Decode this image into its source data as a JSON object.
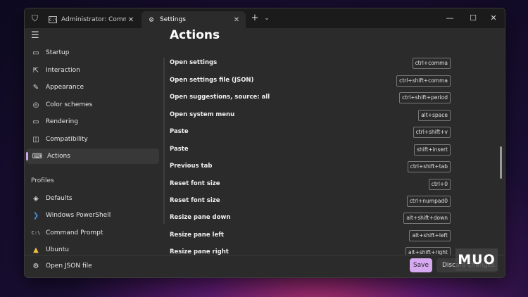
{
  "titlebar": {
    "tabs": [
      {
        "label": "Administrator: Command Pron",
        "icon": "terminal-icon"
      },
      {
        "label": "Settings",
        "icon": "gear-icon",
        "active": true
      }
    ],
    "new_tab_label": "+",
    "dropdown_label": "⌄",
    "close_label": "✕",
    "minimize_label": "—",
    "maximize_label": "☐"
  },
  "sidebar": {
    "items": [
      {
        "label": "Startup",
        "icon": "startup-icon"
      },
      {
        "label": "Interaction",
        "icon": "interaction-icon"
      },
      {
        "label": "Appearance",
        "icon": "brush-icon"
      },
      {
        "label": "Color schemes",
        "icon": "palette-icon"
      },
      {
        "label": "Rendering",
        "icon": "monitor-icon"
      },
      {
        "label": "Compatibility",
        "icon": "compatibility-icon"
      },
      {
        "label": "Actions",
        "icon": "keyboard-icon",
        "selected": true
      }
    ],
    "profiles_heading": "Profiles",
    "profiles": [
      {
        "label": "Defaults",
        "icon": "layers-icon"
      },
      {
        "label": "Windows PowerShell",
        "icon": "powershell-icon"
      },
      {
        "label": "Command Prompt",
        "icon": "terminal-icon"
      },
      {
        "label": "Ubuntu",
        "icon": "ubuntu-icon"
      }
    ]
  },
  "footer": {
    "open_json_label": "Open JSON file",
    "save_label": "Save",
    "discard_label": "Discard changes"
  },
  "main": {
    "title": "Actions",
    "actions": [
      {
        "label": "Open settings",
        "key": "ctrl+comma"
      },
      {
        "label": "Open settings file (JSON)",
        "key": "ctrl+shift+comma"
      },
      {
        "label": "Open suggestions, source: all",
        "key": "ctrl+shift+period"
      },
      {
        "label": "Open system menu",
        "key": "alt+space"
      },
      {
        "label": "Paste",
        "key": "ctrl+shift+v"
      },
      {
        "label": "Paste",
        "key": "shift+insert"
      },
      {
        "label": "Previous tab",
        "key": "ctrl+shift+tab"
      },
      {
        "label": "Reset font size",
        "key": "ctrl+0"
      },
      {
        "label": "Reset font size",
        "key": "ctrl+numpad0"
      },
      {
        "label": "Resize pane down",
        "key": "alt+shift+down"
      },
      {
        "label": "Resize pane left",
        "key": "alt+shift+left"
      },
      {
        "label": "Resize pane right",
        "key": "alt+shift+right"
      }
    ]
  },
  "watermark": "MUO",
  "colors": {
    "accent": "#d7a9f0",
    "window_bg": "#2b2b2b",
    "titlebar_bg": "#1b1b1b"
  }
}
